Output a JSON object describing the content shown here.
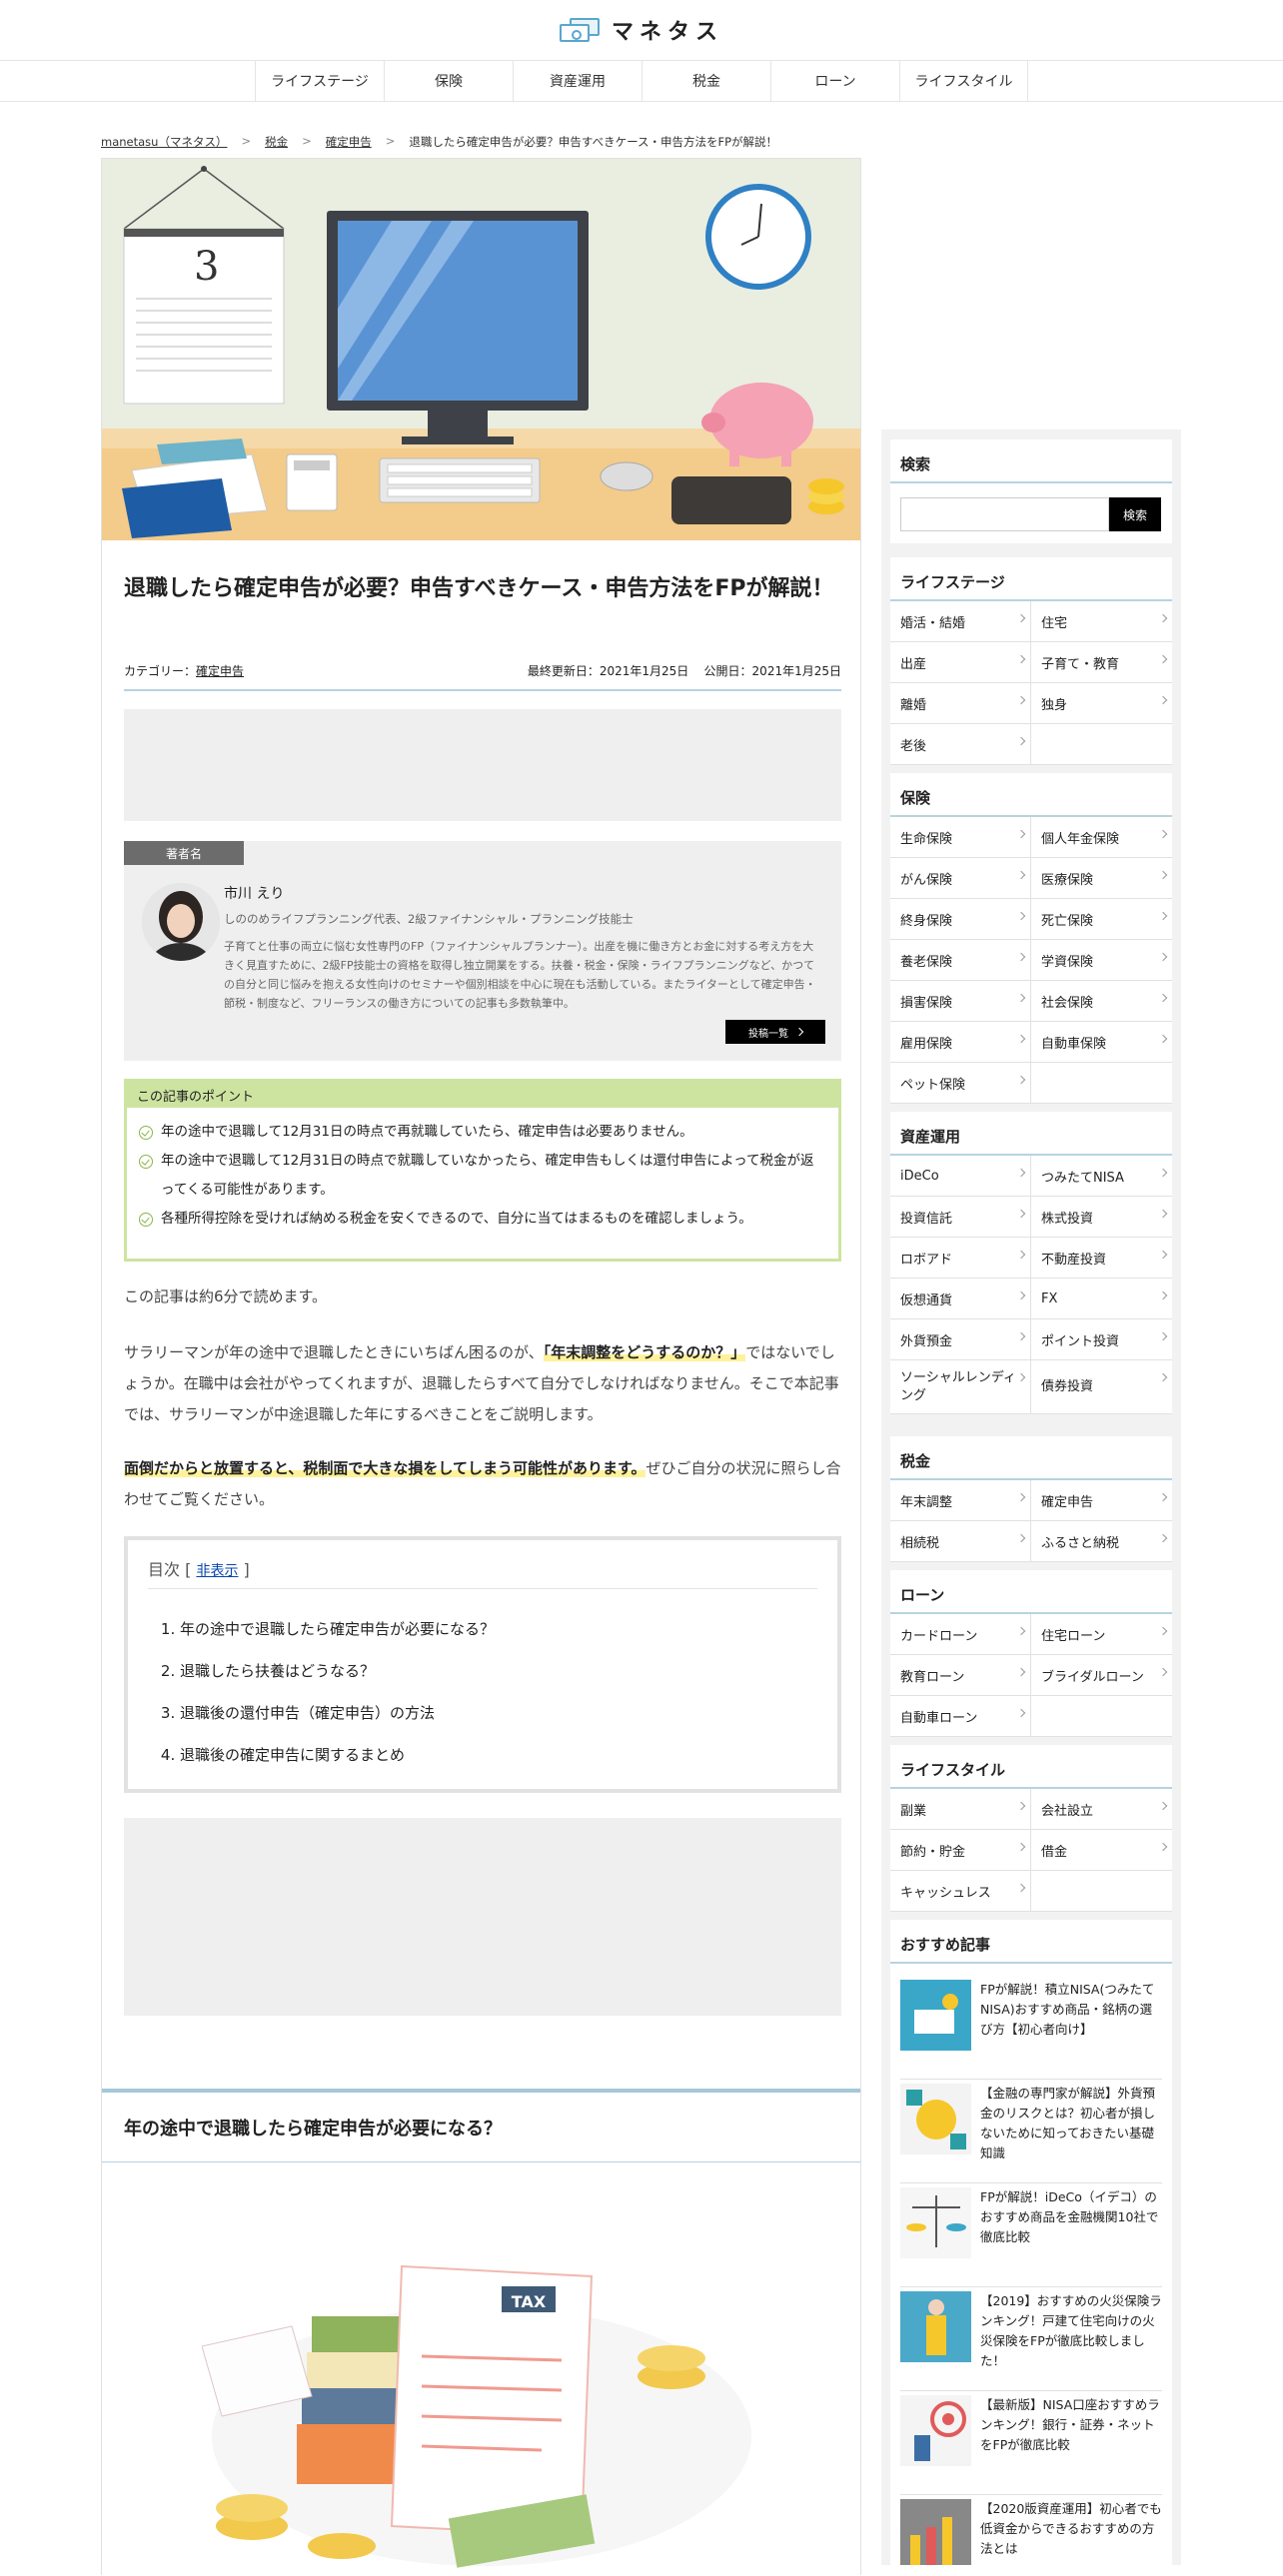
{
  "site": {
    "logo_text": "マネタス"
  },
  "nav": [
    "ライフステージ",
    "保険",
    "資産運用",
    "税金",
    "ローン",
    "ライフスタイル"
  ],
  "breadcrumb": {
    "home": "manetasu（マネタス）",
    "cat": "税金",
    "sub": "確定申告",
    "current": "退職したら確定申告が必要？申告すべきケース・申告方法をFPが解説！",
    "sep": ">"
  },
  "hero": {
    "calendar_day": "3"
  },
  "article": {
    "title": "退職したら確定申告が必要？申告すべきケース・申告方法をFPが解説！",
    "category_label": "カテゴリー：",
    "category": "確定申告",
    "updated": "最終更新日：2021年1月25日",
    "published": "公開日：2021年1月25日"
  },
  "author": {
    "tab": "著者名",
    "name": "市川 えり",
    "role": "しののめライフプランニング代表、2級ファイナンシャル・プランニング技能士",
    "bio": "子育てと仕事の両立に悩む女性専門のFP（ファイナンシャルプランナー）。出産を機に働き方とお金に対する考え方を大きく見直すために、2級FP技能士の資格を取得し独立開業をする。扶養・税金・保険・ライフプランニングなど、かつての自分と同じ悩みを抱える女性向けのセミナーや個別相談を中心に現在も活動している。またライターとして確定申告・節税・制度など、フリーランスの働き方についての記事も多数執筆中。",
    "posts_button": "投稿一覧"
  },
  "points": {
    "header": "この記事のポイント",
    "items": [
      "年の途中で退職して12月31日の時点で再就職していたら、確定申告は必要ありません。",
      "年の途中で退職して12月31日の時点で就職していなかったら、確定申告もしくは還付申告によって税金が返ってくる可能性があります。",
      "各種所得控除を受ければ納める税金を安くできるので、自分に当てはまるものを確認しましょう。"
    ]
  },
  "body": {
    "p1": "この記事は約6分で読めます。",
    "p2a": "サラリーマンが年の途中で退職したときにいちばん困るのが、",
    "p2hl": "「年末調整をどうするのか？」",
    "p2b": "ではないでしょうか。在職中は会社がやってくれますが、退職したらすべて自分でしなければなりません。そこで本記事では、サラリーマンが中途退職した年にするべきことをご説明します。",
    "p3hl": "面倒だからと放置すると、税制面で大きな損をしてしまう可能性があります。",
    "p3b": "ぜひご自分の状況に照らし合わせてご覧ください。"
  },
  "toc": {
    "title": "目次",
    "bracket_open": "[",
    "toggle": "非表示",
    "bracket_close": "]",
    "items": [
      "年の途中で退職したら確定申告が必要になる？",
      "退職したら扶養はどうなる？",
      "退職後の還付申告（確定申告）の方法",
      "退職後の確定申告に関するまとめ"
    ]
  },
  "section1": {
    "heading": "年の途中で退職したら確定申告が必要になる？",
    "tax_label": "TAX"
  },
  "sidebar": {
    "search": {
      "title": "検索",
      "button": "検索",
      "placeholder": ""
    },
    "life_stage": {
      "title": "ライフステージ",
      "items": [
        "婚活・結婚",
        "住宅",
        "出産",
        "子育て・教育",
        "離婚",
        "独身",
        "老後",
        ""
      ]
    },
    "insurance": {
      "title": "保険",
      "items": [
        "生命保険",
        "個人年金保険",
        "がん保険",
        "医療保険",
        "終身保険",
        "死亡保険",
        "養老保険",
        "学資保険",
        "損害保険",
        "社会保険",
        "雇用保険",
        "自動車保険",
        "ペット保険",
        ""
      ]
    },
    "investment": {
      "title": "資産運用",
      "items": [
        "iDeCo",
        "つみたてNISA",
        "投資信託",
        "株式投資",
        "ロボアド",
        "不動産投資",
        "仮想通貨",
        "FX",
        "外貨預金",
        "ポイント投資",
        "ソーシャルレンディング",
        "債券投資"
      ]
    },
    "tax": {
      "title": "税金",
      "items": [
        "年末調整",
        "確定申告",
        "相続税",
        "ふるさと納税"
      ]
    },
    "loan": {
      "title": "ローン",
      "items": [
        "カードローン",
        "住宅ローン",
        "教育ローン",
        "ブライダルローン",
        "自動車ローン",
        ""
      ]
    },
    "lifestyle": {
      "title": "ライフスタイル",
      "items": [
        "副業",
        "会社設立",
        "節約・貯金",
        "借金",
        "キャッシュレス",
        ""
      ]
    },
    "recommended": {
      "title": "おすすめ記事",
      "items": [
        "FPが解説！積立NISA(つみたてNISA)おすすめ商品・銘柄の選び方【初心者向け】",
        "【金融の専門家が解説】外貨預金のリスクとは？初心者が損しないために知っておきたい基礎知識",
        "FPが解説！iDeCo（イデコ）のおすすめ商品を金融機関10社で徹底比較",
        "【2019】おすすめの火災保険ランキング！戸建て住宅向けの火災保険をFPが徹底比較しました！",
        "【最新版】NISA口座おすすめランキング！銀行・証券・ネットをFPが徹底比較",
        "【2020版資産運用】初心者でも低資金からできるおすすめの方法とは"
      ]
    }
  }
}
